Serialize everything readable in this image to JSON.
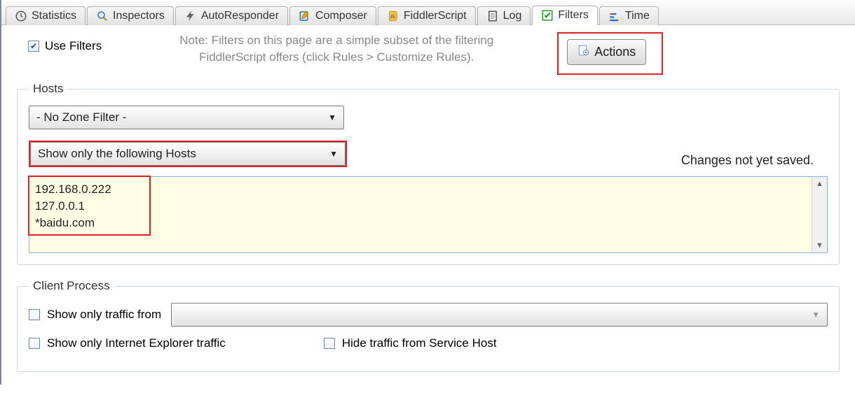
{
  "tabs": {
    "statistics": "Statistics",
    "inspectors": "Inspectors",
    "autoresponder": "AutoResponder",
    "composer": "Composer",
    "fiddlerscript": "FiddlerScript",
    "log": "Log",
    "filters": "Filters",
    "timeline": "Time"
  },
  "top": {
    "use_filters_label": "Use Filters",
    "note_line1": "Note: Filters on this page are a simple subset of the filtering",
    "note_line2": "FiddlerScript offers (click Rules > Customize Rules).",
    "actions_label": "Actions"
  },
  "hosts": {
    "legend": "Hosts",
    "zone_filter": "- No Zone Filter -",
    "host_filter": "Show only the following Hosts",
    "status": "Changes not yet saved.",
    "list": "192.168.0.222\n127.0.0.1\n*baidu.com"
  },
  "client": {
    "legend": "Client Process",
    "show_only_from": "Show only traffic from",
    "show_only_ie": "Show only Internet Explorer traffic",
    "hide_service_host": "Hide traffic from Service Host"
  }
}
